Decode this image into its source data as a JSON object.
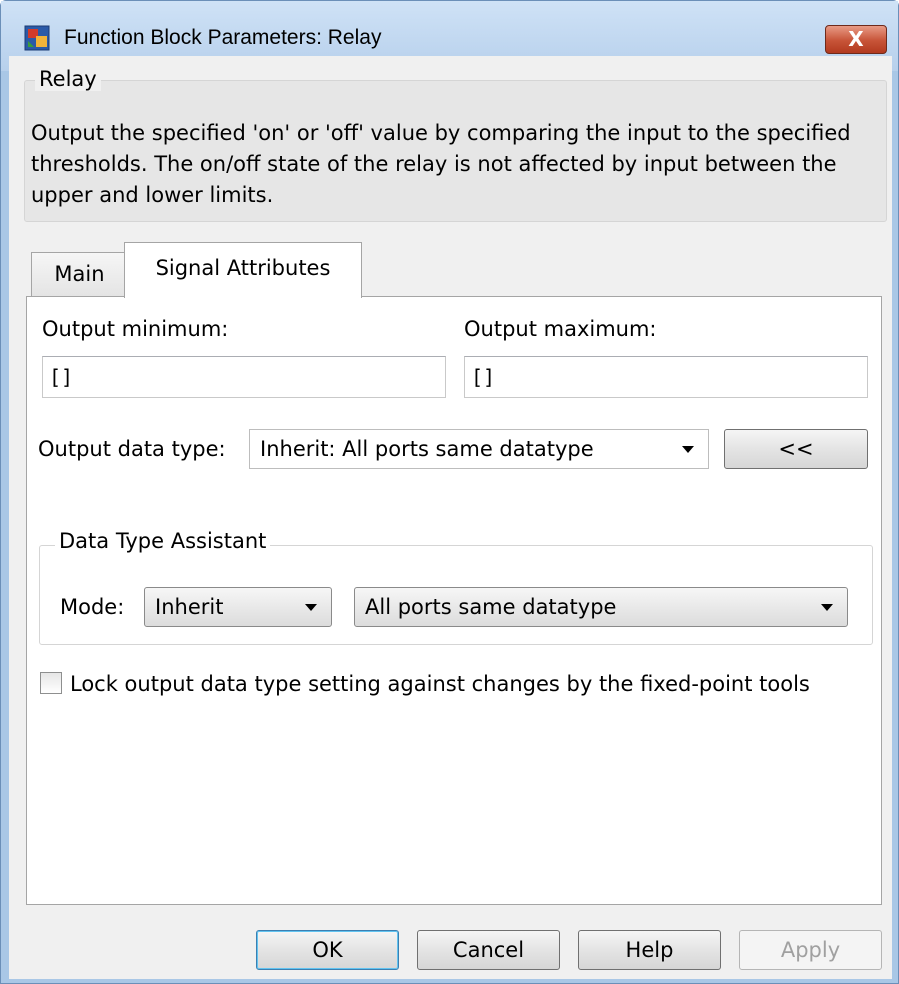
{
  "window": {
    "title": "Function Block Parameters: Relay",
    "close_glyph": "X",
    "app_icon": "simulink-block-icon"
  },
  "description": {
    "group_title": "Relay",
    "text": "Output the specified 'on' or 'off' value by comparing the input to the specified thresholds.  The on/off state of the relay is not affected by input between the upper and lower limits."
  },
  "tabs": [
    {
      "label": "Main",
      "active": false
    },
    {
      "label": "Signal Attributes",
      "active": true
    }
  ],
  "signal_attributes": {
    "output_min_label": "Output minimum:",
    "output_min_value": "[]",
    "output_max_label": "Output maximum:",
    "output_max_value": "[]",
    "output_dtype_label": "Output data type:",
    "output_dtype_value": "Inherit: All ports same datatype",
    "assistant_toggle_label": "<<",
    "assistant": {
      "title": "Data Type Assistant",
      "mode_label": "Mode:",
      "mode_value": "Inherit",
      "inherit_rule_value": "All ports same datatype"
    },
    "lock_checkbox_label": "Lock output data type setting against changes by the fixed-point tools",
    "lock_checked": false
  },
  "buttons": {
    "ok": "OK",
    "cancel": "Cancel",
    "help": "Help",
    "apply": "Apply"
  }
}
